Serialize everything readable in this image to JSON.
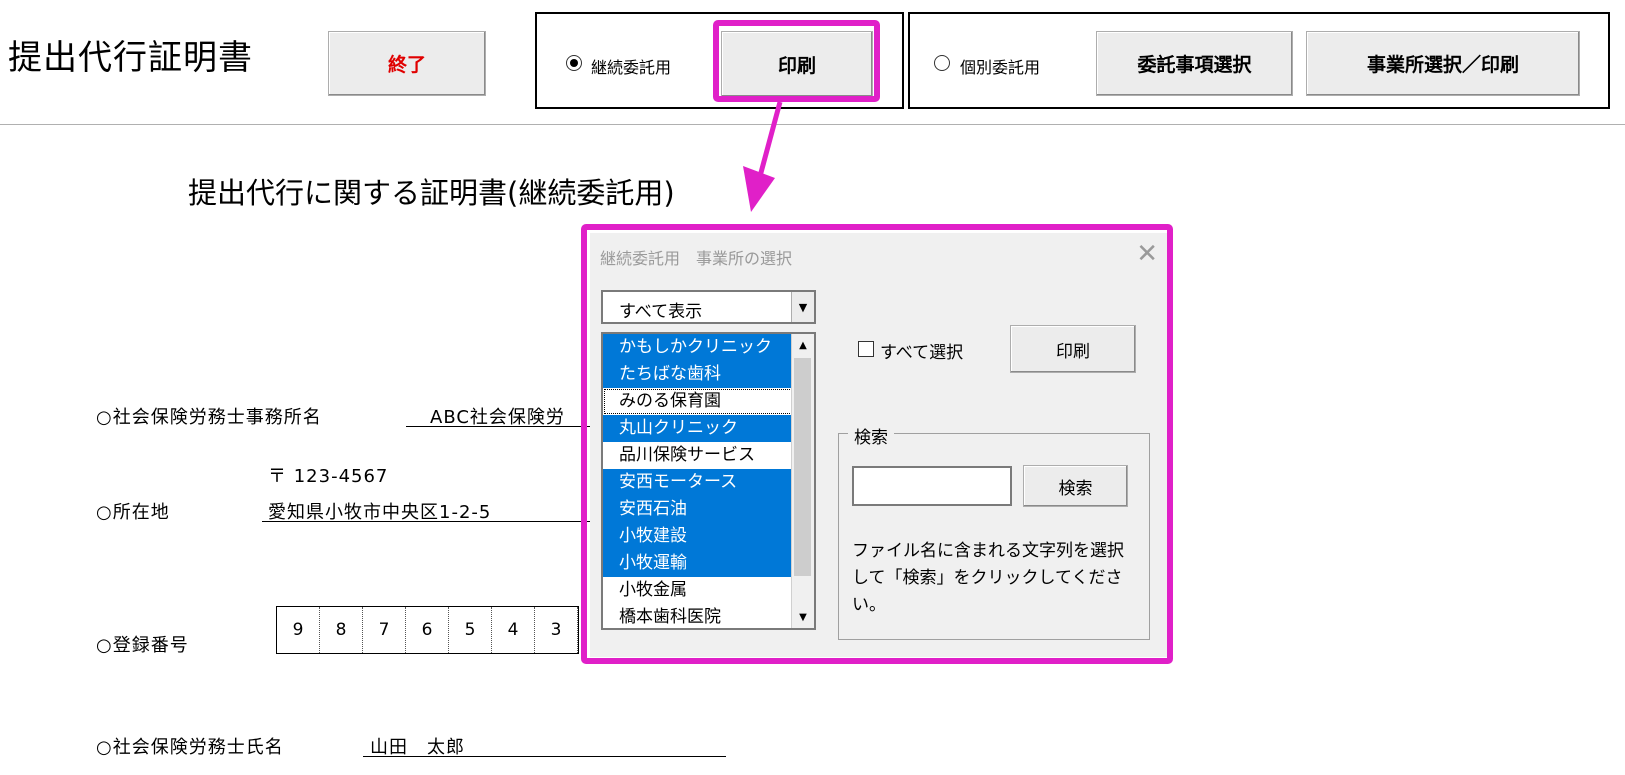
{
  "app": {
    "title": "提出代行証明書"
  },
  "toolbar": {
    "exit_label": "終了",
    "exit_color": "#e00000",
    "continuous_label": "継続委託用",
    "print_label": "印刷",
    "individual_label": "個別委託用",
    "select_items_label": "委託事項選択",
    "select_office_print_label": "事業所選択／印刷"
  },
  "document": {
    "title": "提出代行に関する証明書(継続委託用)",
    "office_name_label": "○社会保険労務士事務所名",
    "office_name_value": "ABC社会保険労",
    "postal": "〒 123-4567",
    "address_label": "○所在地",
    "address_value": "愛知県小牧市中央区1-2-5",
    "registration_label": "○登録番号",
    "registration_digits": [
      "9",
      "8",
      "7",
      "6",
      "5",
      "4",
      "3"
    ],
    "name_label": "○社会保険労務士氏名",
    "name_value": "山田　太郎"
  },
  "dialog": {
    "title": "継続委託用　事業所の選択",
    "close_icon": "close-icon",
    "filter_value": "すべて表示",
    "offices": [
      {
        "label": "かもしかクリニック",
        "selected": true
      },
      {
        "label": "たちばな歯科",
        "selected": true
      },
      {
        "label": "みのる保育園",
        "selected": false,
        "focused": true
      },
      {
        "label": "丸山クリニック",
        "selected": true
      },
      {
        "label": "品川保険サービス",
        "selected": false
      },
      {
        "label": "安西モータース",
        "selected": true
      },
      {
        "label": "安西石油",
        "selected": true
      },
      {
        "label": "小牧建設",
        "selected": true
      },
      {
        "label": "小牧運輸",
        "selected": true
      },
      {
        "label": "小牧金属",
        "selected": false
      },
      {
        "label": "橋本歯科医院",
        "selected": false
      }
    ],
    "select_all_label": "すべて選択",
    "print_label": "印刷",
    "search_group_label": "検索",
    "search_value": "",
    "search_button_label": "検索",
    "help_text": "ファイル名に含まれる文字列を選択して「検索」をクリックしてください。"
  },
  "colors": {
    "highlight": "#e020c8",
    "selection": "#0078d7"
  }
}
